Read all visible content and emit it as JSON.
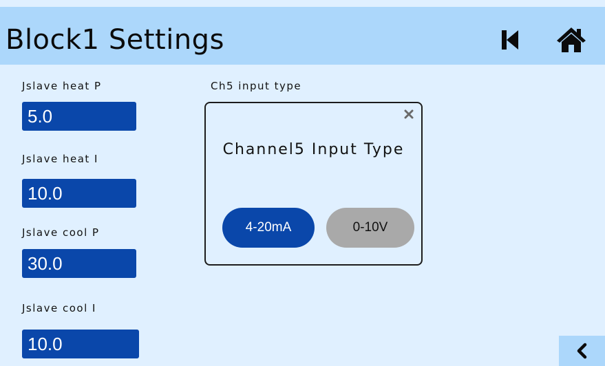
{
  "colors": {
    "background": "#e0f0ff",
    "header": "#acd7fb",
    "field_fill": "#0a47aa",
    "selected_option": "#0a47aa",
    "unselected_option": "#a9a9a9"
  },
  "header": {
    "title": "Block1 Settings",
    "icons": [
      "skip-to-first-icon",
      "home-icon"
    ]
  },
  "fields": [
    {
      "label": "Jslave heat P",
      "value": "5.0"
    },
    {
      "label": "Jslave heat I",
      "value": "10.0"
    },
    {
      "label": "Jslave cool P",
      "value": "30.0"
    },
    {
      "label": "Jslave cool I",
      "value": "10.0"
    }
  ],
  "channel": {
    "label": "Ch5 input type"
  },
  "dialog": {
    "title": "Channel5 Input Type",
    "close_icon": "close-icon",
    "options": [
      {
        "label": "4-20mA",
        "selected": true
      },
      {
        "label": "0-10V",
        "selected": false
      }
    ]
  },
  "footer": {
    "back_icon": "chevron-left-icon"
  }
}
